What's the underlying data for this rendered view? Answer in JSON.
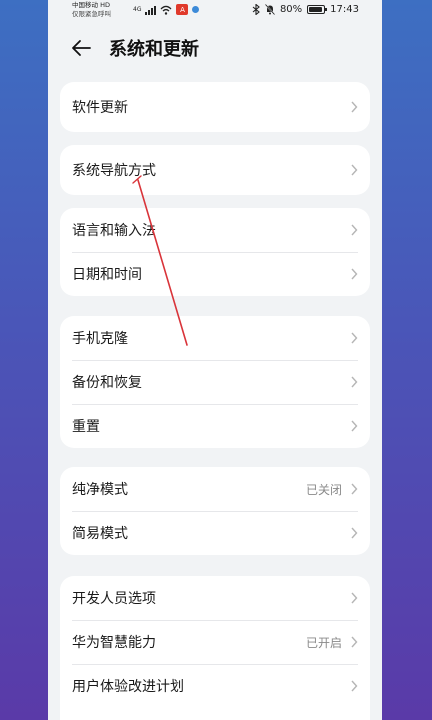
{
  "status_bar": {
    "carrier_line1": "中国移动 HD",
    "carrier_line2": "仅限紧急呼叫",
    "network": "4G",
    "app_badge": "A",
    "battery": "80%",
    "time": "17:43"
  },
  "header": {
    "title": "系统和更新"
  },
  "groups": [
    {
      "items": [
        {
          "label": "软件更新"
        }
      ]
    },
    {
      "items": [
        {
          "label": "系统导航方式"
        }
      ]
    },
    {
      "items": [
        {
          "label": "语言和输入法"
        },
        {
          "label": "日期和时间"
        }
      ]
    },
    {
      "items": [
        {
          "label": "手机克隆"
        },
        {
          "label": "备份和恢复"
        },
        {
          "label": "重置"
        }
      ]
    },
    {
      "items": [
        {
          "label": "纯净模式",
          "value": "已关闭"
        },
        {
          "label": "简易模式"
        }
      ]
    },
    {
      "items": [
        {
          "label": "开发人员选项"
        },
        {
          "label": "华为智慧能力",
          "value": "已开启"
        },
        {
          "label": "用户体验改进计划"
        }
      ]
    }
  ],
  "colors": {
    "annotation_line": "#d9343a",
    "card_bg": "#ffffff",
    "page_bg": "#f1f3f5"
  }
}
